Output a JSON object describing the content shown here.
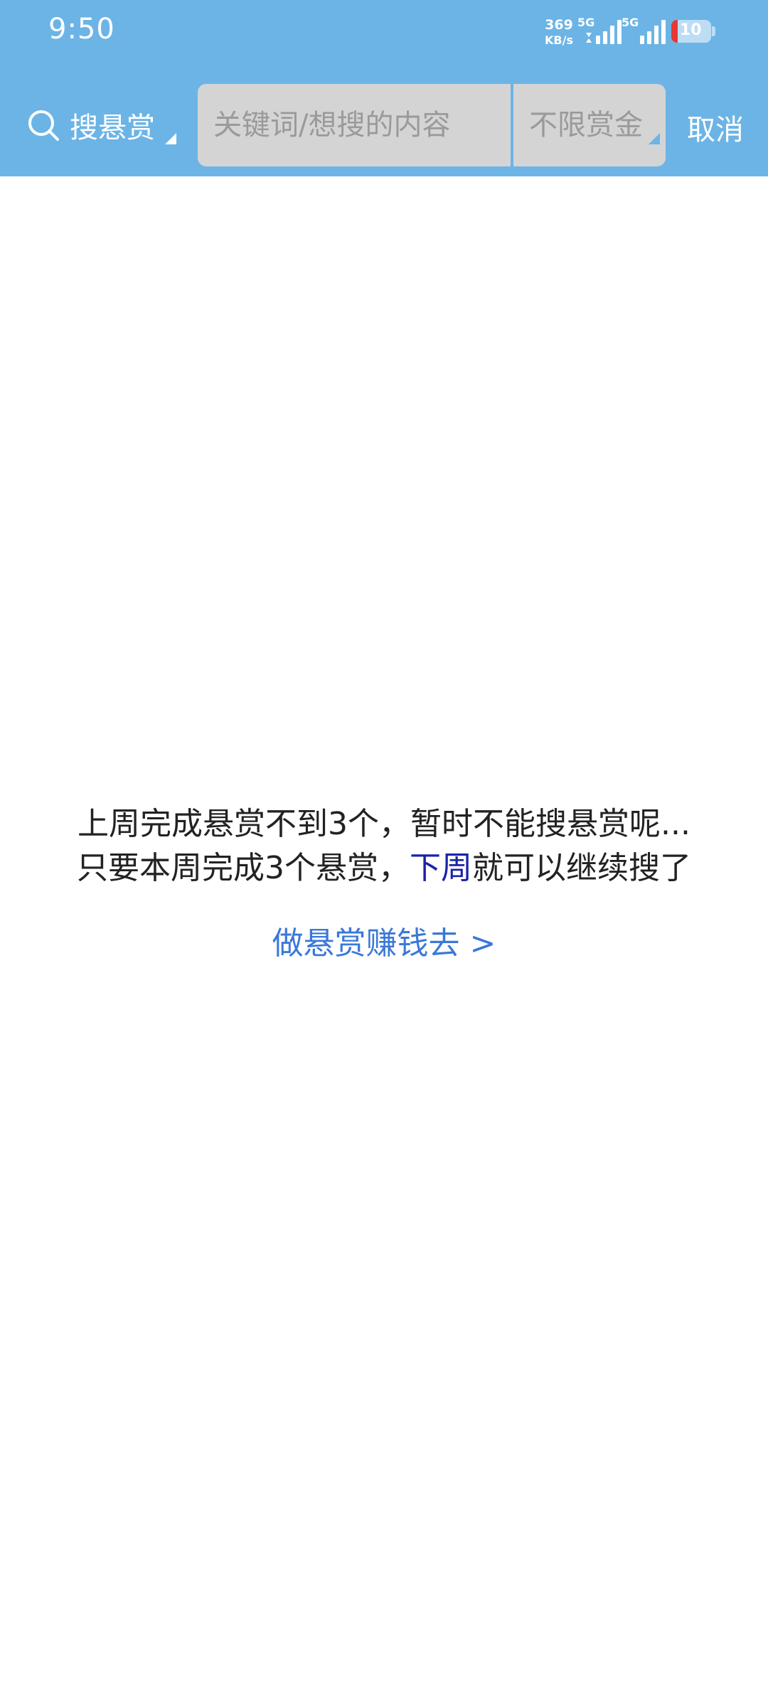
{
  "status_bar": {
    "time": "9:50",
    "net_speed_value": "369",
    "net_speed_unit": "KB/s",
    "sim1_label": "5G",
    "sim2_label": "5G",
    "battery_level": "10"
  },
  "search_bar": {
    "scope_label": "搜悬赏",
    "input_placeholder": "关键词/想搜的内容",
    "reward_filter_label": "不限赏金",
    "cancel_label": "取消"
  },
  "notice": {
    "line1": "上周完成悬赏不到3个，暂时不能搜悬赏呢...",
    "line2_before": "只要本周完成3个悬赏，",
    "line2_highlight": "下周",
    "line2_after": "就可以继续搜了",
    "cta_label": "做悬赏赚钱去 >"
  },
  "colors": {
    "header_bg": "#6cb4e6",
    "search_box_bg": "#d4d4d4",
    "highlight_text": "#1a22a8",
    "link_text": "#3a78d8",
    "battery_low": "#e53935"
  }
}
